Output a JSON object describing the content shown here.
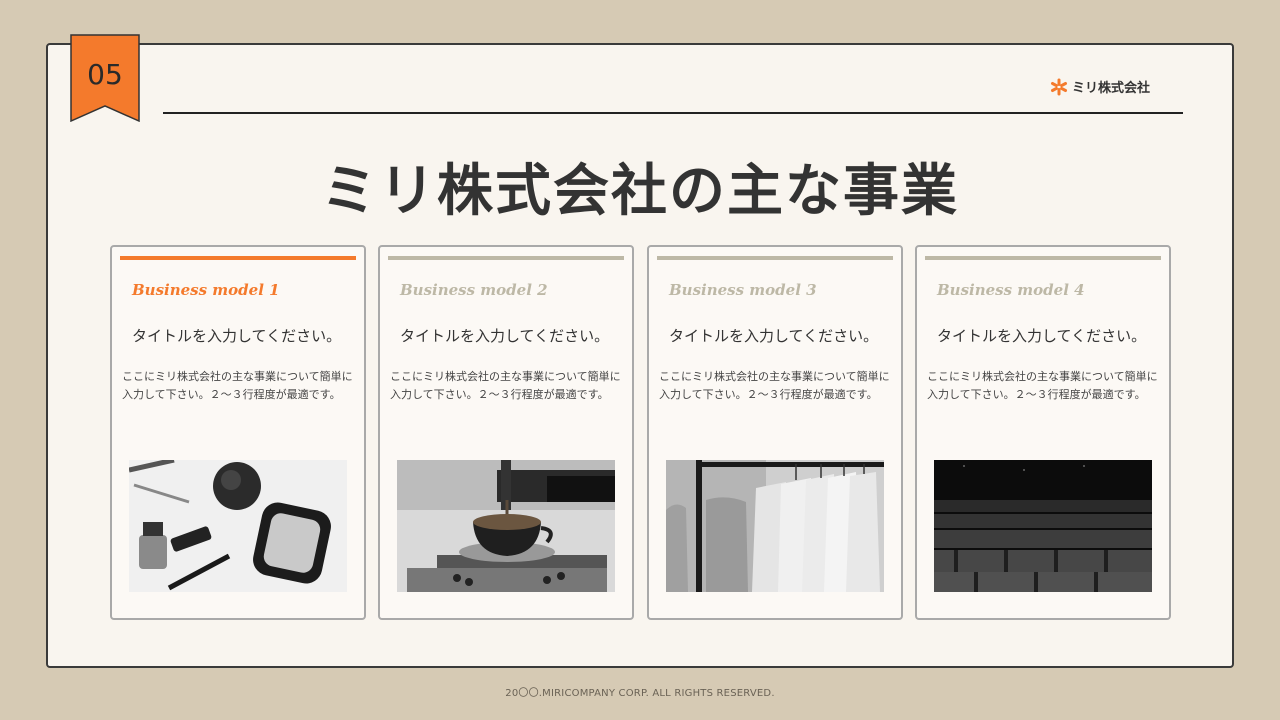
{
  "page": {
    "number": "05",
    "brand": "ミリ株式会社",
    "title": "ミリ株式会社の主な事業",
    "footer": "20〇〇.MIRICOMPANY CORP. ALL RIGHTS RESERVED."
  },
  "colors": {
    "accent": "#f47a2c",
    "inactive": "#bdb8a6",
    "background": "#d6cab4",
    "slide": "#f9f5ef"
  },
  "cards": [
    {
      "model": "Business model 1",
      "title": "タイトルを入力してください。",
      "desc": "ここにミリ株式会社の主な事業について簡単に入力して下さい。２〜３行程度が最適です。",
      "image": "cosmetics-photo",
      "active": true
    },
    {
      "model": "Business model 2",
      "title": "タイトルを入力してください。",
      "desc": "ここにミリ株式会社の主な事業について簡単に入力して下さい。２〜３行程度が最適です。",
      "image": "espresso-photo",
      "active": false
    },
    {
      "model": "Business model 3",
      "title": "タイトルを入力してください。",
      "desc": "ここにミリ株式会社の主な事業について簡単に入力して下さい。２〜３行程度が最適です。",
      "image": "shirts-rack-photo",
      "active": false
    },
    {
      "model": "Business model 4",
      "title": "タイトルを入力してください。",
      "desc": "ここにミリ株式会社の主な事業について簡単に入力して下さい。２〜３行程度が最適です。",
      "image": "theater-seats-photo",
      "active": false
    }
  ]
}
